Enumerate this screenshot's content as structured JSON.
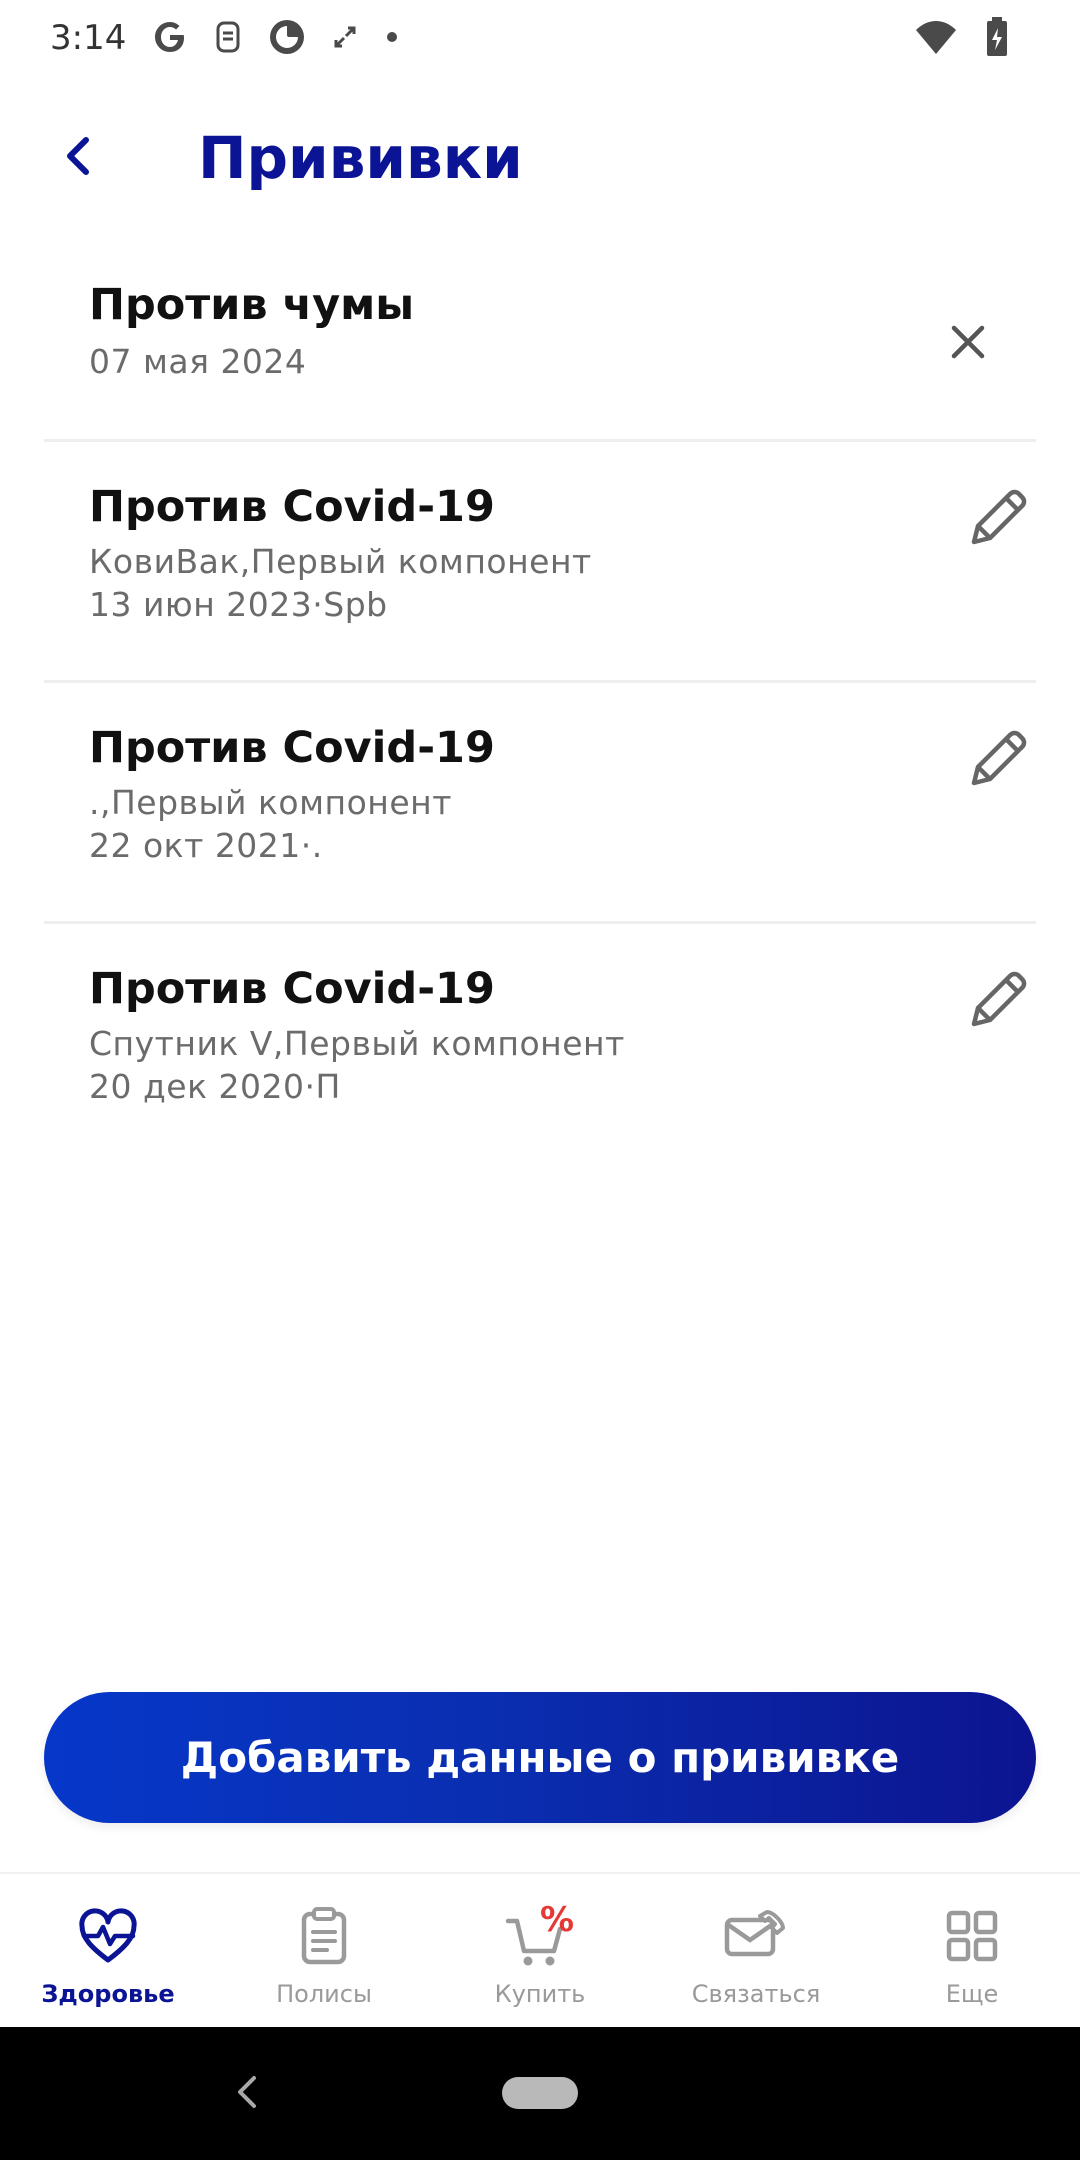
{
  "status_bar": {
    "time": "3:14",
    "left_icons": [
      "google-icon",
      "sim-toolkit-icon",
      "browser-icon",
      "expand-icon",
      "dot-icon"
    ],
    "right_icons": [
      "wifi-icon",
      "battery-charging-icon"
    ]
  },
  "header": {
    "title": "Прививки",
    "back_icon": "chevron-left-icon"
  },
  "vaccinations": [
    {
      "title": "Против чумы",
      "line1": "07 мая 2024",
      "line2": "",
      "action_icon": "close-icon"
    },
    {
      "title": "Против Covid-19",
      "line1": "КовиВак,Первый компонент",
      "line2": "13 июн 2023·Spb",
      "action_icon": "pencil-icon"
    },
    {
      "title": "Против Covid-19",
      "line1": ".,Первый компонент",
      "line2": "22 окт 2021·.",
      "action_icon": "pencil-icon"
    },
    {
      "title": "Против Covid-19",
      "line1": "Спутник V,Первый компонент",
      "line2": "20 дек 2020·П",
      "action_icon": "pencil-icon"
    }
  ],
  "add_button": {
    "label": "Добавить данные о прививке"
  },
  "bottom_nav": {
    "items": [
      {
        "label": "Здоровье",
        "icon": "heart-pulse-icon",
        "active": true
      },
      {
        "label": "Полисы",
        "icon": "clipboard-icon",
        "active": false
      },
      {
        "label": "Купить",
        "icon": "cart-percent-icon",
        "active": false
      },
      {
        "label": "Связаться",
        "icon": "envelope-phone-icon",
        "active": false
      },
      {
        "label": "Еще",
        "icon": "grid-icon",
        "active": false
      }
    ]
  },
  "colors": {
    "accent": "#0a1494",
    "button_gradient_start": "#0637c9",
    "button_gradient_end": "#0c1490",
    "nav_inactive": "#9a9a9a",
    "sale_red": "#e53935"
  }
}
